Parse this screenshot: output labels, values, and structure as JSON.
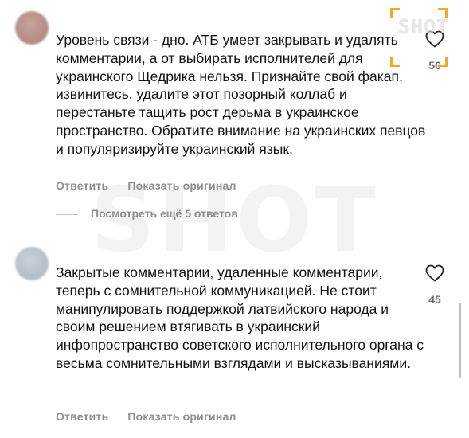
{
  "watermark": "SHOT",
  "logo": {
    "text": "SHOT",
    "accent_color": "#f5a623"
  },
  "comments": [
    {
      "text": "Уровень связи - дно. АТБ умеет закрывать и удалять комментарии, а от выбирать исполнителей для украинского Щедрика нельзя. Признайте свой факап, извинитесь, удалите этот позорный коллаб и перестаньте тащить рост дерьма в украинское пространство. Обратите внимание на украинских певцов и популяризируйте украинский язык.",
      "reply_label": "Ответить",
      "see_original_label": "Показать оригинал",
      "likes": "56"
    },
    {
      "text": "Закрытые комментарии, удаленные комментарии, теперь с сомнительной коммуникацией. Не стоит манипулировать поддержкой латвийского народа и своим решением втягивать в украинский инфопространство советского исполнительного органа с весьма сомнительными взглядами и высказываниями.",
      "reply_label": "Ответить",
      "see_original_label": "Показать оригинал",
      "likes": "45"
    }
  ],
  "view_replies_label": "Посмотреть ещё 5 ответов",
  "icons": {
    "like": "heart-outline-icon"
  }
}
